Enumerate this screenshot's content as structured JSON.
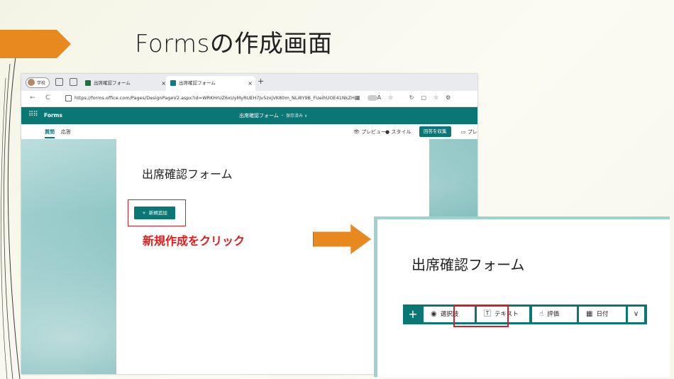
{
  "slide": {
    "title": "Formsの作成画面"
  },
  "browser": {
    "profile_label": "学校",
    "tabs": [
      {
        "label": "出席確認フォーム",
        "close": "×"
      },
      {
        "label": "出席確認フォーム",
        "close": "×"
      }
    ],
    "new_tab": "+",
    "back": "←",
    "refresh": "C",
    "url": "https://forms.office.com/Pages/DesignPageV2.aspx?id=WRKHrUZ6xUyMyRUEH7Jv5zxjVK80m_NLi8Y9B_FUeihUOE41NkZH..."
  },
  "forms": {
    "app_name": "Forms",
    "doc_title": "出席確認フォーム",
    "doc_state": "・ 保存済み ∨",
    "tab_questions": "質問",
    "tab_responses": "応答",
    "preview": "プレビュー",
    "style": "スタイル",
    "collect": "回答を収集",
    "present": "プレ",
    "form_title": "出席確認フォーム",
    "new_button": "新規追加",
    "new_button_icon": "+"
  },
  "annotation": {
    "click_note": "新規作成をクリック"
  },
  "zoom": {
    "form_title": "出席確認フォーム",
    "add_icon": "+",
    "options": [
      {
        "label": "選択肢",
        "icon": "radio-icon"
      },
      {
        "label": "テキスト",
        "icon": "text-icon"
      },
      {
        "label": "評価",
        "icon": "thumb-icon"
      },
      {
        "label": "日付",
        "icon": "calendar-icon"
      }
    ],
    "more_icon": "chevron-down-icon"
  },
  "colors": {
    "accent": "#0b7775",
    "highlight": "#d2202a",
    "arrow": "#e8891f",
    "note": "#e41b1b"
  }
}
